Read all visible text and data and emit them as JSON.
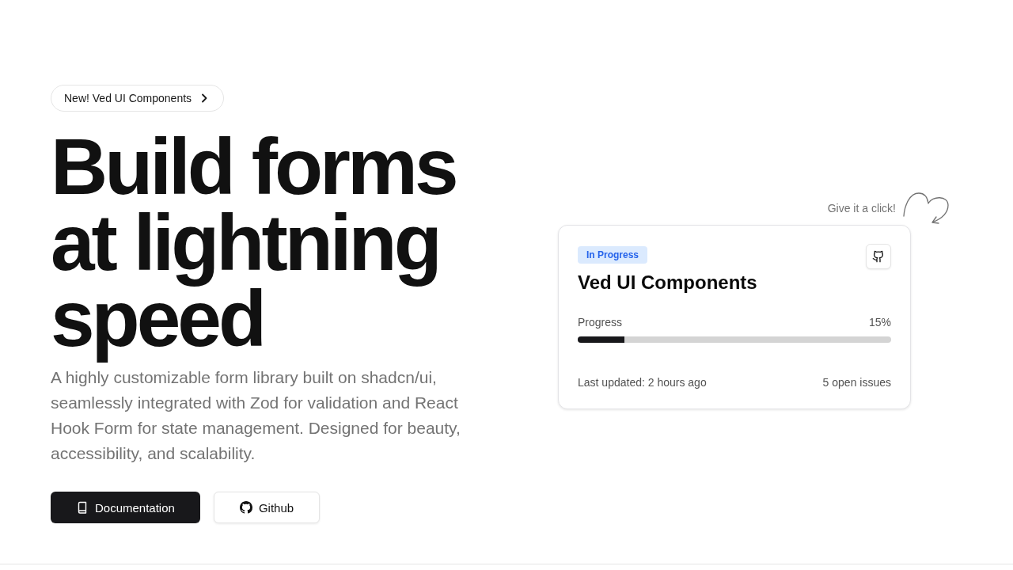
{
  "announcement": {
    "label": "New! Ved UI Components"
  },
  "hero": {
    "headline": "Build forms at lightning speed",
    "description": "A highly customizable form library built on shadcn/ui, seamlessly integrated with Zod for validation and React Hook Form for state management. Designed for beauty, accessibility, and scalability.",
    "buttons": [
      {
        "label": "Documentation",
        "kind": "primary"
      },
      {
        "label": "Github",
        "kind": "secondary"
      }
    ]
  },
  "hint": "Give it a click!",
  "project_card": {
    "status": "In Progress",
    "title": "Ved UI Components",
    "progress": {
      "label": "Progress",
      "reading": "15%",
      "level": 0.15
    },
    "updated": "Last updated: 2 hours ago",
    "issues": "5 open issues"
  }
}
